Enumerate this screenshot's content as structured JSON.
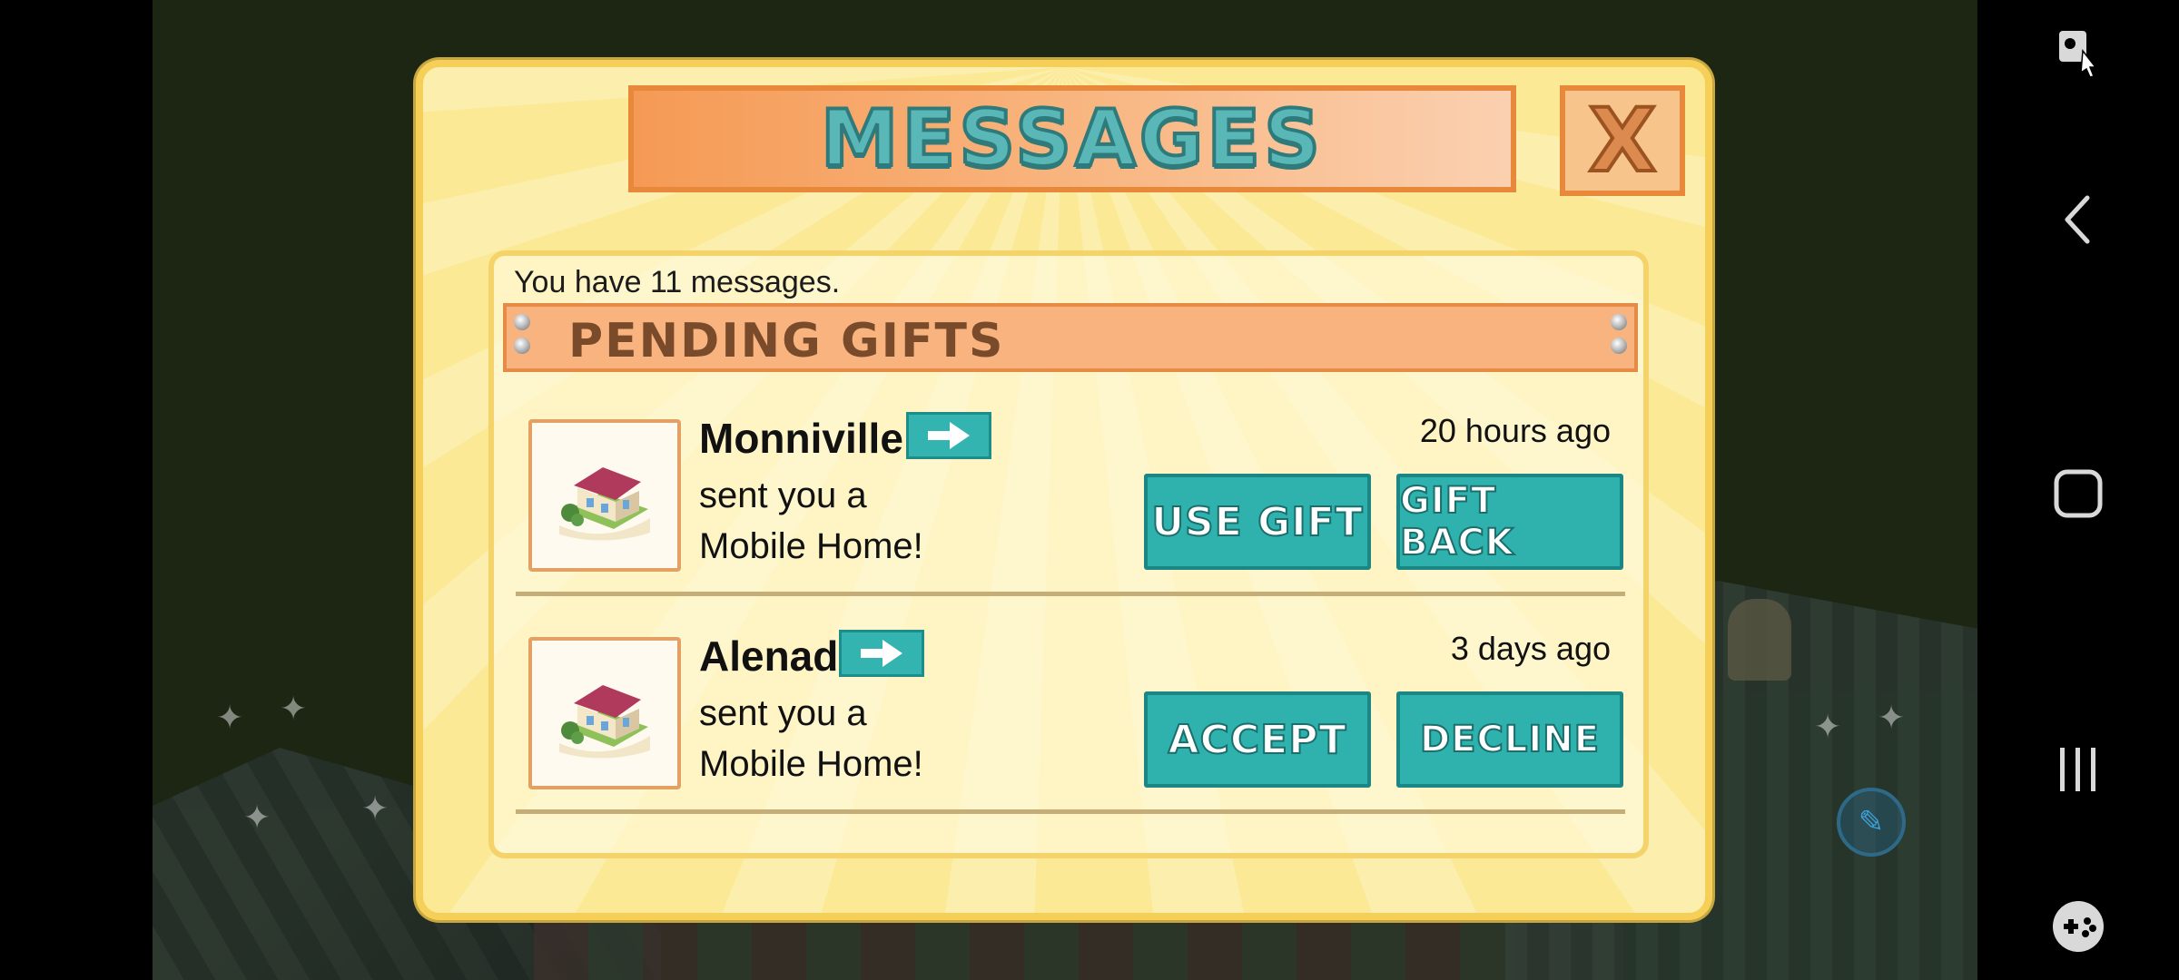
{
  "dialog": {
    "title": "MESSAGES",
    "close_label": "X",
    "message_count_text": "You have 11 messages.",
    "section_title": "PENDING GIFTS"
  },
  "gifts": [
    {
      "sender": "Monniville",
      "line1": "sent you a",
      "line2": "Mobile Home!",
      "time": "20 hours ago",
      "primary_label": "USE GIFT",
      "secondary_label": "GIFT BACK"
    },
    {
      "sender": "Alenad",
      "line1": "sent you a",
      "line2": "Mobile Home!",
      "time": "3 days ago",
      "primary_label": "ACCEPT",
      "secondary_label": "DECLINE"
    }
  ],
  "icons": {
    "thumbnail": "mobile-home-icon",
    "profile": "arrow-right-icon",
    "nav": [
      "screen-capture-icon",
      "back-icon",
      "home-icon",
      "recents-icon",
      "game-launcher-icon"
    ]
  },
  "colors": {
    "dialog_bg": "#fbe996",
    "banner": "#f59a55",
    "button": "#2fb2ae",
    "title_text": "#59b7b7"
  }
}
